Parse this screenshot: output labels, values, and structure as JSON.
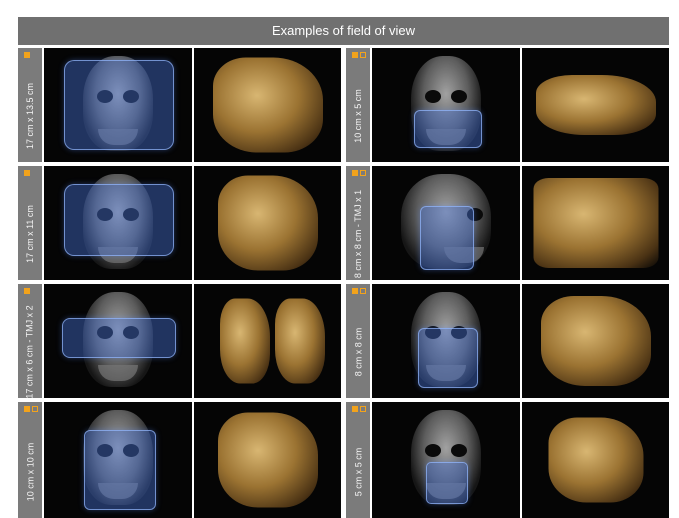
{
  "header": {
    "title": "Examples of field of view"
  },
  "colors": {
    "header_bg": "#707070",
    "sidebar_bg": "#7b7b7b",
    "marker": "#f2a31c",
    "fov_box": "#4977e0"
  },
  "left": [
    {
      "label": "17 cm x 13.5 cm",
      "markers": [
        "filled"
      ]
    },
    {
      "label": "17 cm x 11 cm",
      "markers": [
        "filled"
      ]
    },
    {
      "label": "17 cm x 6 cm - TMJ x 2",
      "markers": [
        "filled"
      ]
    },
    {
      "label": "10 cm x 10 cm",
      "markers": [
        "filled",
        "hollow"
      ]
    }
  ],
  "right": [
    {
      "label": "10 cm x 5 cm",
      "markers": [
        "filled",
        "hollow"
      ]
    },
    {
      "label": "8 cm x 8 cm - TMJ x 1",
      "markers": [
        "filled",
        "hollow"
      ]
    },
    {
      "label": "8 cm x 8 cm",
      "markers": [
        "filled",
        "hollow"
      ]
    },
    {
      "label": "5 cm x 5 cm",
      "markers": [
        "filled",
        "hollow"
      ]
    }
  ]
}
